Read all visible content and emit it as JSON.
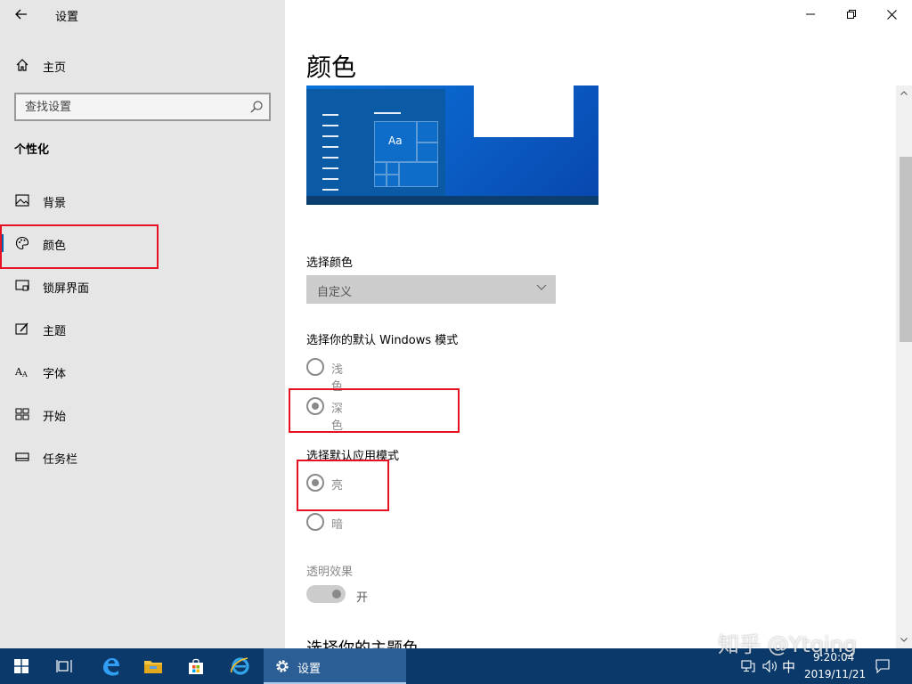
{
  "window": {
    "title": "设置"
  },
  "sidebar": {
    "home_label": "主页",
    "search_placeholder": "查找设置",
    "section_heading": "个性化",
    "items": [
      {
        "label": "背景",
        "icon": "image-icon"
      },
      {
        "label": "颜色",
        "icon": "palette-icon",
        "selected": true
      },
      {
        "label": "锁屏界面",
        "icon": "lock-screen-icon"
      },
      {
        "label": "主题",
        "icon": "theme-brush-icon"
      },
      {
        "label": "字体",
        "icon": "font-icon"
      },
      {
        "label": "开始",
        "icon": "start-grid-icon"
      },
      {
        "label": "任务栏",
        "icon": "taskbar-icon"
      }
    ]
  },
  "main": {
    "title": "颜色",
    "preview_text": "Aa",
    "choose_color_label": "选择颜色",
    "choose_color_value": "自定义",
    "windows_mode_label": "选择你的默认 Windows 模式",
    "windows_mode_options": [
      {
        "label": "浅色",
        "checked": false
      },
      {
        "label": "深色",
        "checked": true
      }
    ],
    "app_mode_label": "选择默认应用模式",
    "app_mode_options": [
      {
        "label": "亮",
        "checked": true
      },
      {
        "label": "暗",
        "checked": false
      }
    ],
    "transparency_label": "透明效果",
    "transparency_state": "开",
    "next_heading": "选择你的主题色"
  },
  "taskbar": {
    "settings_label": "设置",
    "ime": "中",
    "time": "9:20:04",
    "date": "2019/11/21"
  },
  "watermark": "知乎 @Ytqing",
  "colors": {
    "accent": "#0063b1",
    "sidebar_bg": "#e6e6e6",
    "taskbar_bg": "#0b3a6a",
    "highlight_box": "#e81123"
  }
}
